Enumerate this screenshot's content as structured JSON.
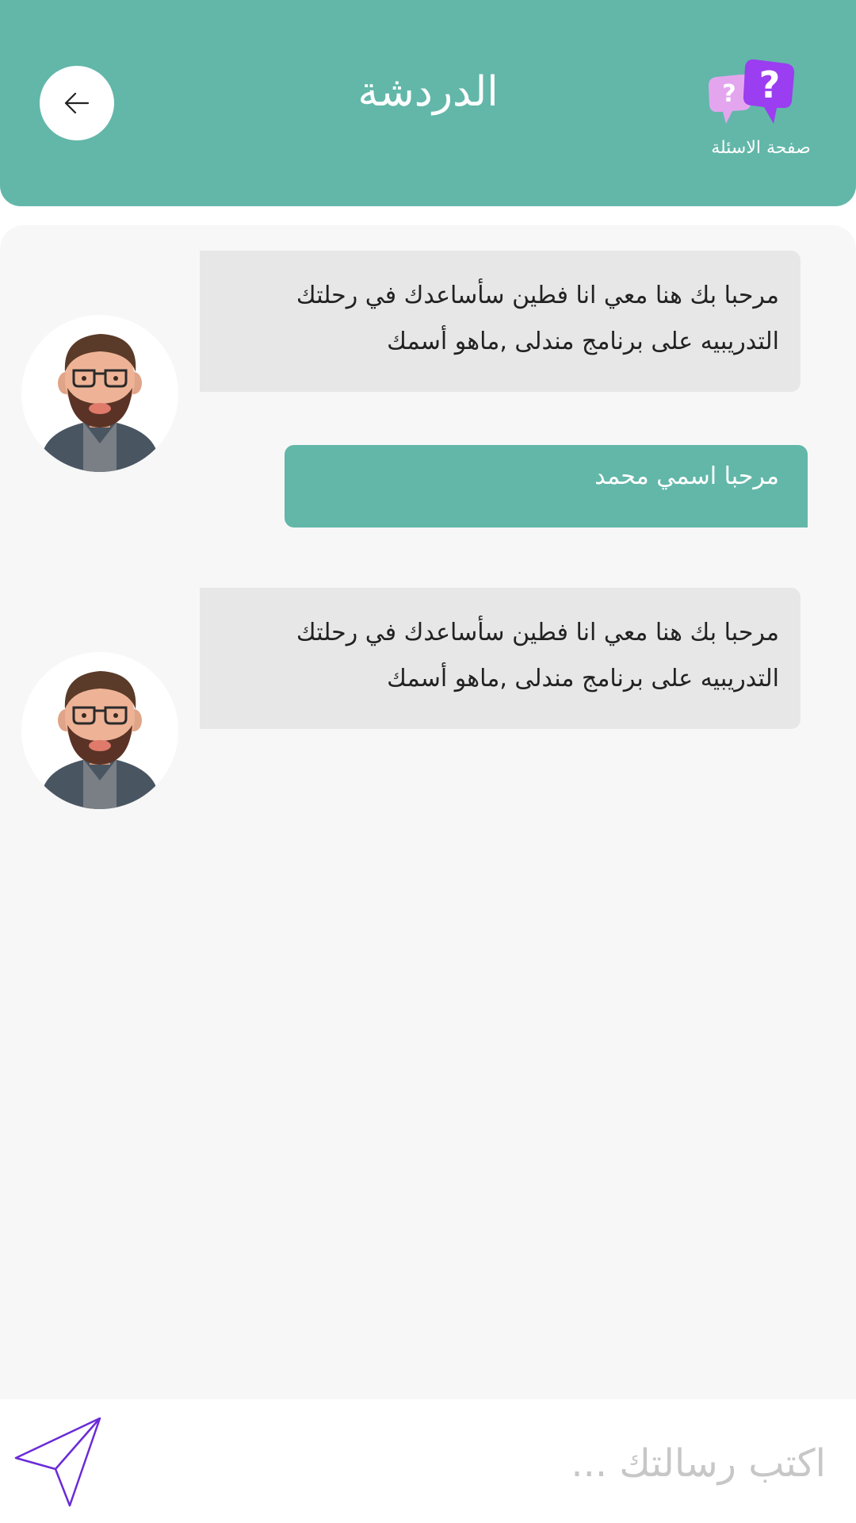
{
  "header": {
    "title": "الدردشة",
    "questions_label": "صفحة الاسئلة"
  },
  "messages": [
    {
      "sender": "bot",
      "text": "مرحبا بك هنا معي انا فطين سأساعدك في رحلتك التدريبيه على برنامج مندلى ,ماهو أسمك"
    },
    {
      "sender": "user",
      "text": "مرحبا اسمي محمد"
    },
    {
      "sender": "bot",
      "text": "مرحبا بك هنا معي انا فطين سأساعدك في رحلتك التدريبيه على برنامج مندلى ,ماهو أسمك"
    }
  ],
  "input": {
    "placeholder": "اكتب رسالتك ..."
  },
  "icons": {
    "back": "arrow-left-icon",
    "questions": "question-bubbles-icon",
    "send": "paper-plane-icon",
    "avatar": "bot-avatar"
  },
  "colors": {
    "primary": "#62b7a9",
    "bot_bubble": "#e7e7e7",
    "send_icon": "#6a2bd8",
    "question_icon": "#9b3df0"
  }
}
